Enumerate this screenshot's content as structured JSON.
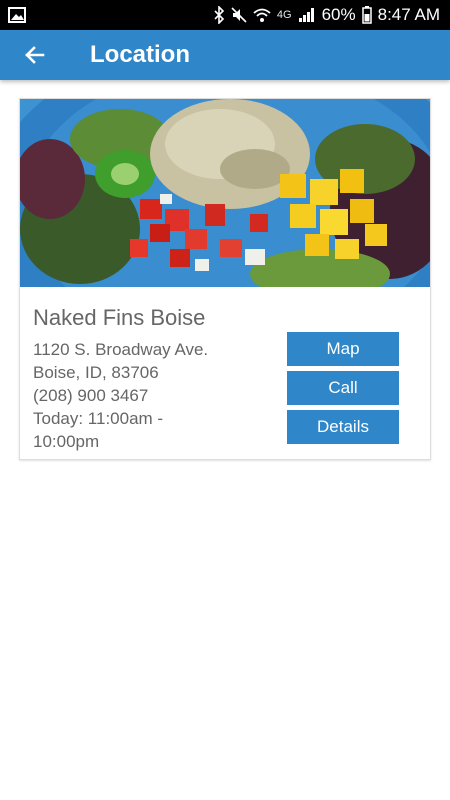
{
  "status": {
    "network": "4G",
    "battery": "60%",
    "time": "8:47 AM"
  },
  "app_bar": {
    "title": "Location"
  },
  "location": {
    "name": "Naked Fins Boise",
    "address_line1": "1120 S. Broadway Ave.",
    "address_line2": "Boise, ID, 83706",
    "phone": "(208) 900 3467",
    "hours_line1": "Today: 11:00am -",
    "hours_line2": "10:00pm"
  },
  "actions": {
    "map": "Map",
    "call": "Call",
    "details": "Details"
  },
  "colors": {
    "primary": "#2f86c8",
    "text": "#666666"
  },
  "icons": {
    "back": "arrow-left-icon",
    "gallery": "image-icon"
  }
}
